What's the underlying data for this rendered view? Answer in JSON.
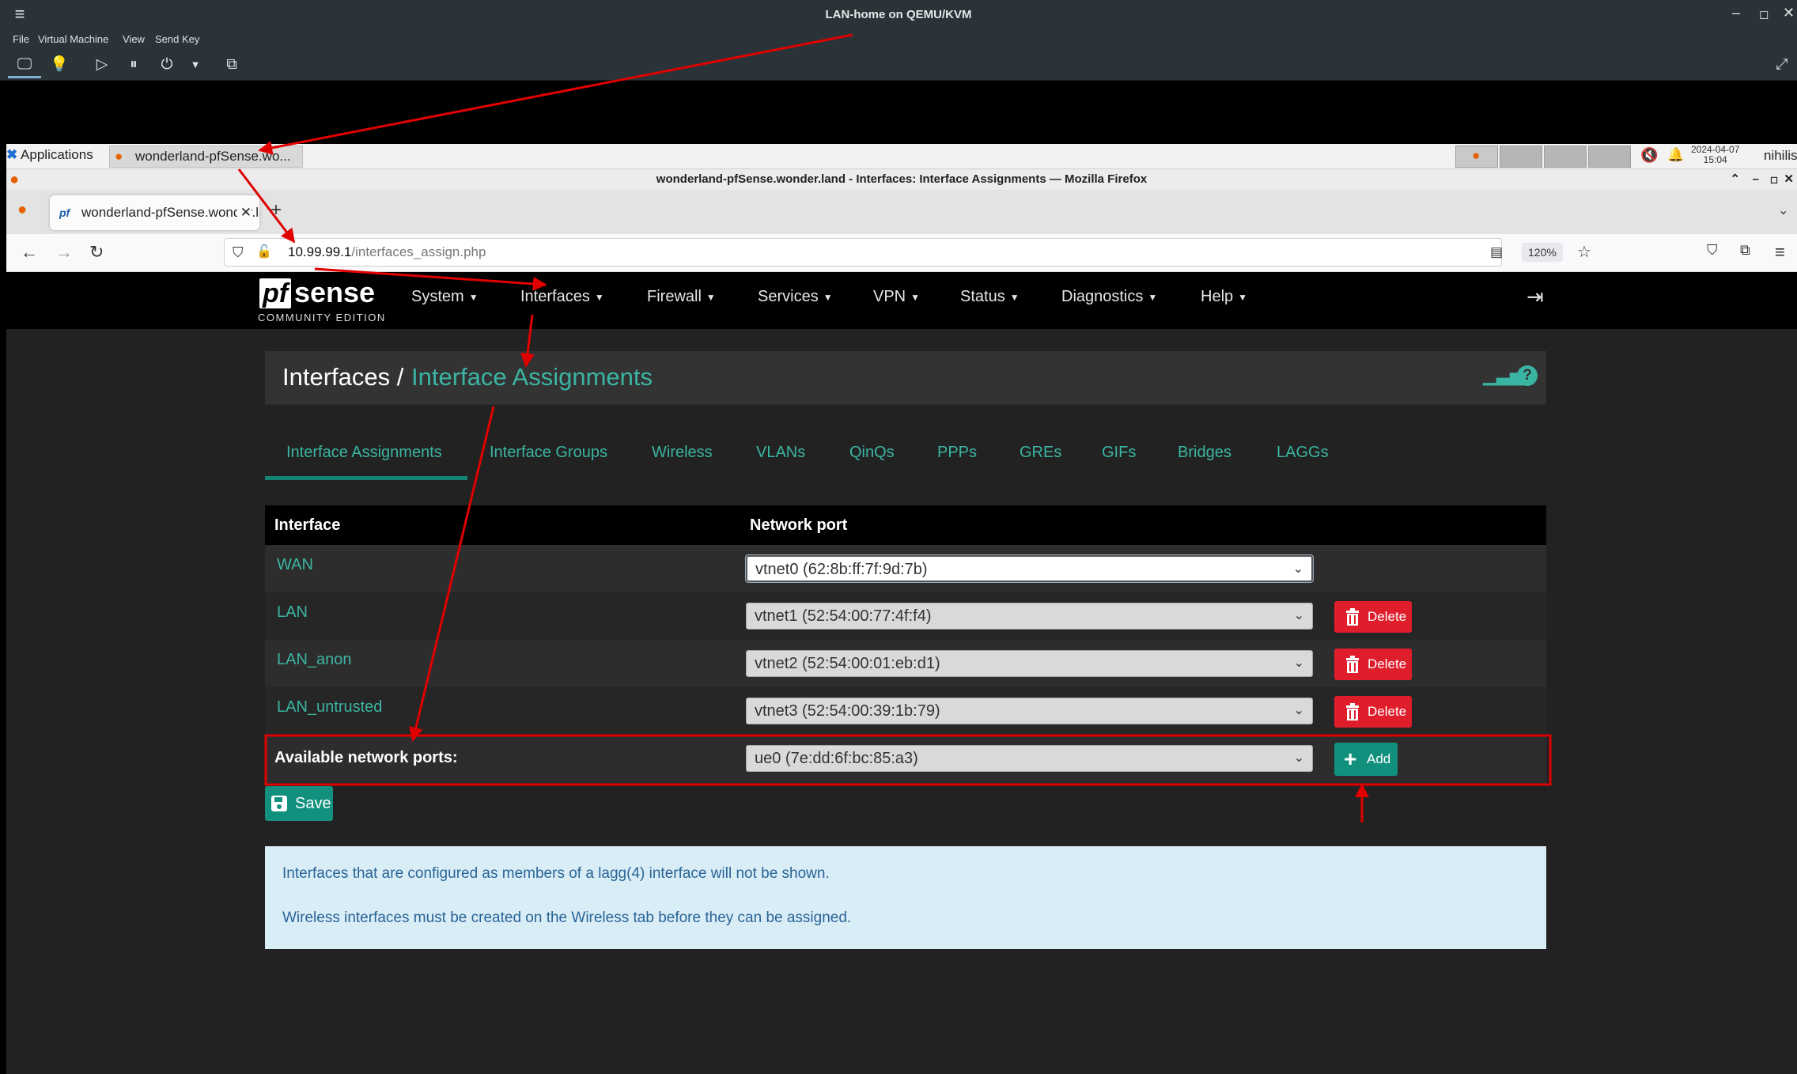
{
  "qemu": {
    "title": "LAN-home on QEMU/KVM",
    "menu": [
      "File",
      "Virtual Machine",
      "View",
      "Send Key"
    ]
  },
  "desktop_panel": {
    "applications_label": "Applications",
    "task_label": "wonderland-pfSense.wo...",
    "clock_date": "2024-04-07",
    "clock_time": "15:04",
    "user": "nihilis"
  },
  "firefox": {
    "window_title": "wonderland-pfSense.wonder.land - Interfaces: Interface Assignments — Mozilla Firefox",
    "tab_title": "wonderland-pfSense.wonder.land",
    "url_host": "10.99.99.1",
    "url_path": "/interfaces_assign.php",
    "zoom": "120%"
  },
  "pfsense": {
    "logo_pf": "pf",
    "logo_sense": "sense",
    "logo_edition": "COMMUNITY EDITION",
    "menu": [
      "System",
      "Interfaces",
      "Firewall",
      "Services",
      "VPN",
      "Status",
      "Diagnostics",
      "Help"
    ],
    "breadcrumb": {
      "section": "Interfaces",
      "separator": "/",
      "page": "Interface Assignments"
    },
    "tabs": [
      "Interface Assignments",
      "Interface Groups",
      "Wireless",
      "VLANs",
      "QinQs",
      "PPPs",
      "GREs",
      "GIFs",
      "Bridges",
      "LAGGs"
    ],
    "active_tab": "Interface Assignments",
    "table": {
      "headers": {
        "interface": "Interface",
        "port": "Network port"
      },
      "rows": [
        {
          "name": "WAN",
          "port": "vtnet0 (62:8b:ff:7f:9d:7b)",
          "deletable": false
        },
        {
          "name": "LAN",
          "port": "vtnet1 (52:54:00:77:4f:f4)",
          "deletable": true
        },
        {
          "name": "LAN_anon",
          "port": "vtnet2 (52:54:00:01:eb:d1)",
          "deletable": true
        },
        {
          "name": "LAN_untrusted",
          "port": "vtnet3 (52:54:00:39:1b:79)",
          "deletable": true
        }
      ],
      "delete_label": "Delete",
      "available_label": "Available network ports:",
      "available_port": "ue0 (7e:dd:6f:bc:85:a3)",
      "add_label": "Add"
    },
    "save_label": "Save",
    "info": [
      "Interfaces that are configured as members of a lagg(4) interface will not be shown.",
      "Wireless interfaces must be created on the Wireless tab before they can be assigned."
    ]
  },
  "colors": {
    "accent": "#3bb5a3",
    "add_button": "#11917d",
    "delete_button": "#e01d2b",
    "annotation": "#e00000",
    "info_bg": "#d9edf7"
  }
}
